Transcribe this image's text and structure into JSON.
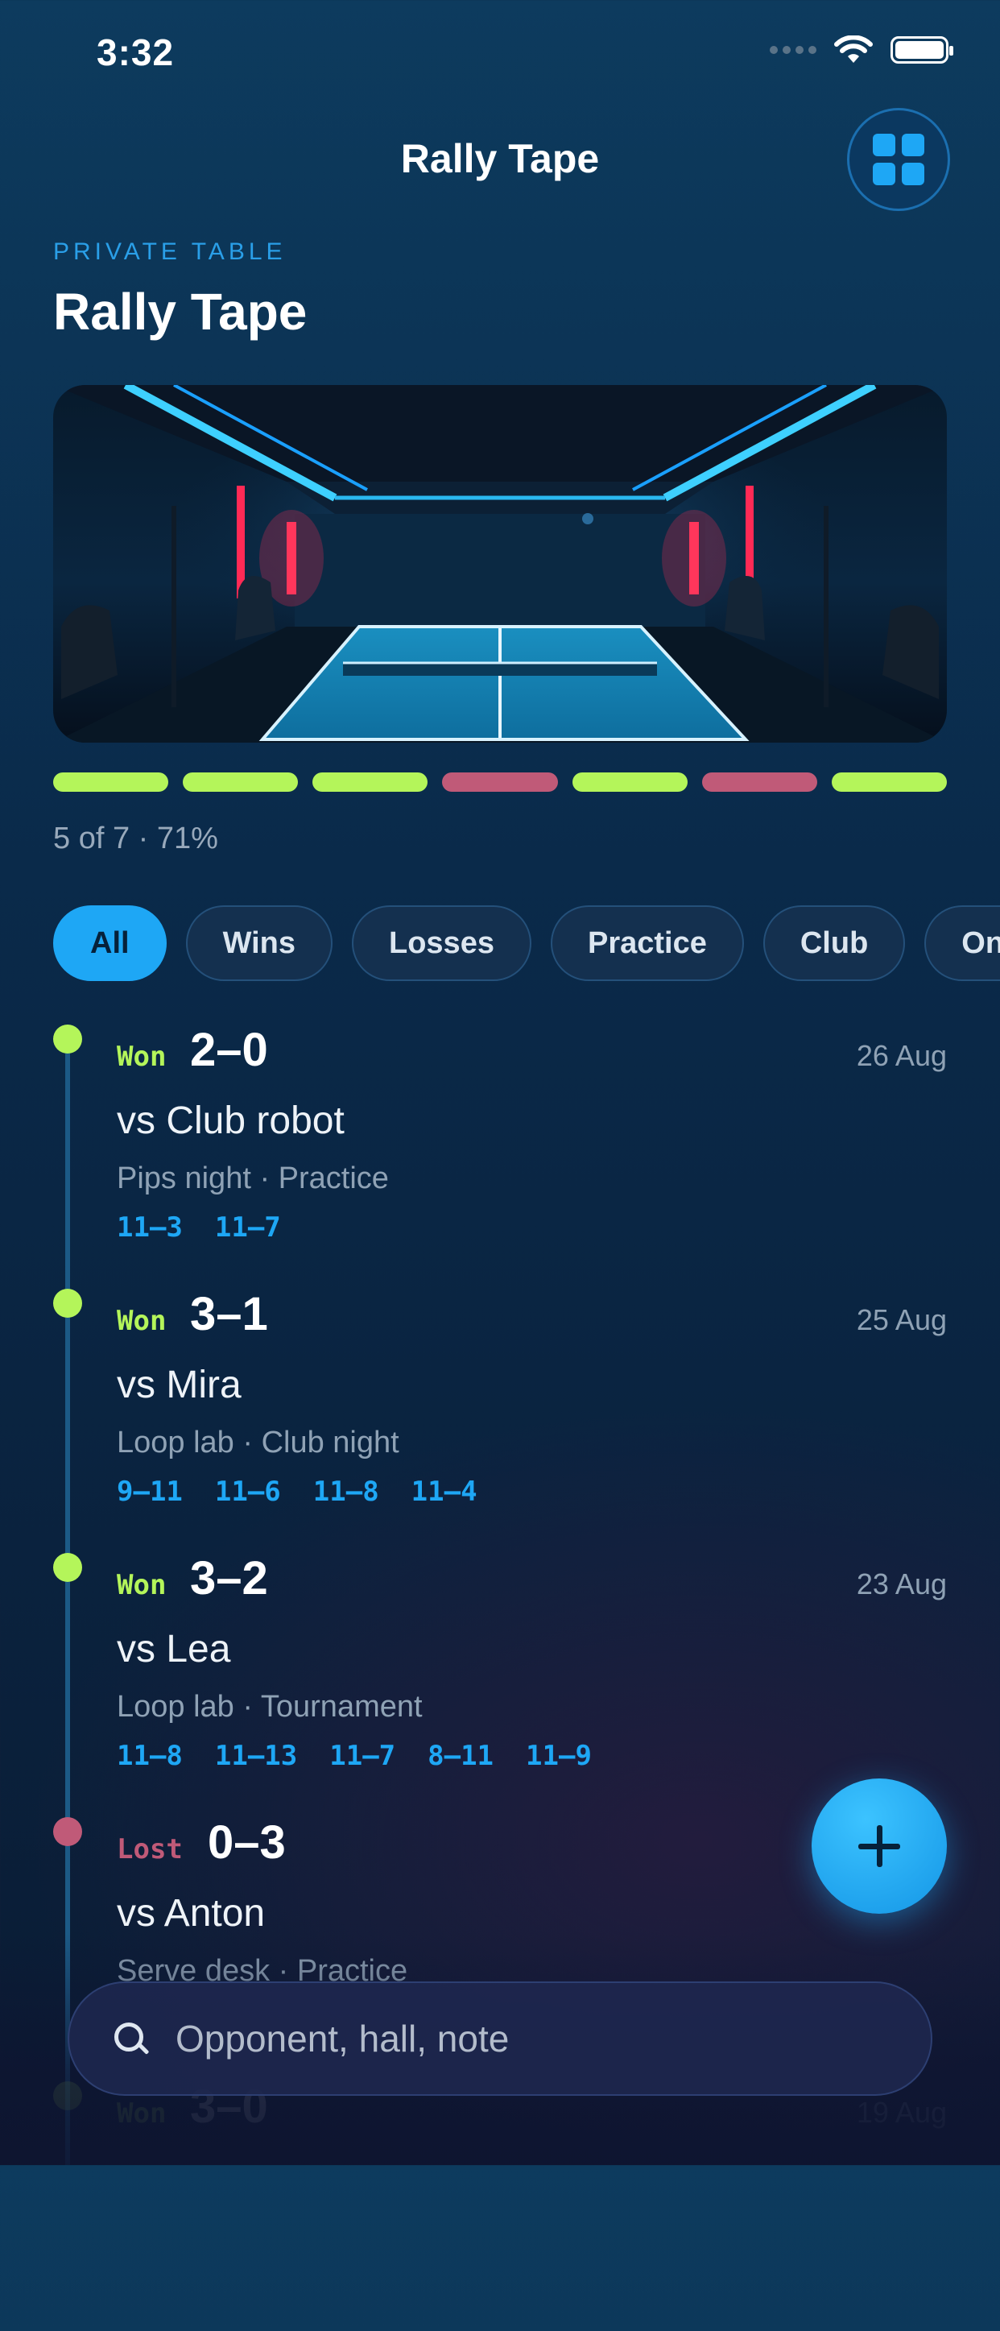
{
  "status": {
    "time": "3:32"
  },
  "nav": {
    "title": "Rally Tape",
    "menu_icon": "grid-icon"
  },
  "header": {
    "eyebrow": "PRIVATE TABLE",
    "title": "Rally Tape"
  },
  "hero": {
    "icon": "ping-pong-room-image"
  },
  "progress": {
    "segments": [
      "win",
      "win",
      "win",
      "loss",
      "win",
      "loss",
      "win"
    ],
    "text": "5 of 7 · 71%",
    "win_fraction": 0.71
  },
  "filters": [
    "All",
    "Wins",
    "Losses",
    "Practice",
    "Club",
    "On-t"
  ],
  "matches": [
    {
      "result": "Won",
      "score": "2–0",
      "date": "26 Aug",
      "opponent": "vs Club robot",
      "meta": "Pips night · Practice",
      "sets": [
        "11–3",
        "11–7"
      ]
    },
    {
      "result": "Won",
      "score": "3–1",
      "date": "25 Aug",
      "opponent": "vs Mira",
      "meta": "Loop lab · Club night",
      "sets": [
        "9–11",
        "11–6",
        "11–8",
        "11–4"
      ]
    },
    {
      "result": "Won",
      "score": "3–2",
      "date": "23 Aug",
      "opponent": "vs Lea",
      "meta": "Loop lab · Tournament",
      "sets": [
        "11–8",
        "11–13",
        "11–7",
        "8–11",
        "11–9"
      ]
    },
    {
      "result": "Lost",
      "score": "0–3",
      "date": "",
      "opponent": "vs Anton",
      "meta": "Serve desk · Practice",
      "sets": []
    },
    {
      "result": "Won",
      "score": "3–0",
      "date": "19 Aug",
      "opponent": "",
      "meta": "",
      "sets": []
    }
  ],
  "search": {
    "placeholder": "Opponent, hall, note"
  },
  "colors": {
    "accent": "#1ea7f5",
    "win": "#b4f55a",
    "loss": "#c05a78",
    "background": "#0a2a4a"
  }
}
